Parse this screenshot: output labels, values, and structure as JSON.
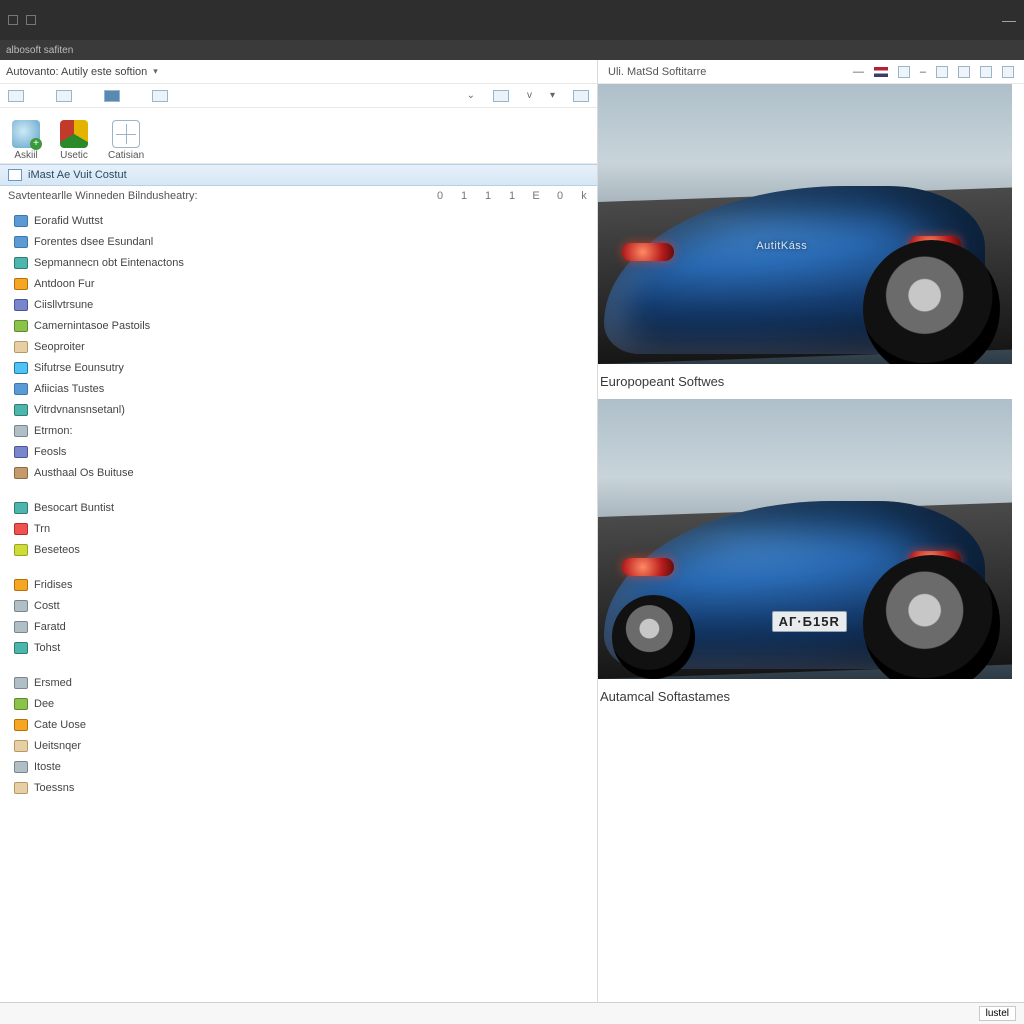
{
  "chrome": {
    "subtitle": "albosoft safiten",
    "minimize": "—"
  },
  "left": {
    "crumb": "Autovanto: Autily este softion",
    "toolbar": [
      {
        "name": "askil",
        "label": "Askiil"
      },
      {
        "name": "usetic",
        "label": "Usetic"
      },
      {
        "name": "catisian",
        "label": "Catisian"
      }
    ],
    "category_bar": "iMast Ae Vuit Costut",
    "section_title": "Savtentearlle Winneden Bilndusheatry:",
    "tally": [
      "0",
      "1",
      "1",
      "1",
      "E",
      "0",
      "k"
    ],
    "tree_a": [
      {
        "c": "c-blue",
        "t": "Eorafid Wuttst"
      },
      {
        "c": "c-blue",
        "t": "Forentes dsee Esundanl"
      },
      {
        "c": "c-teal",
        "t": "Sepmannecn obt Eintenactons"
      },
      {
        "c": "c-orange",
        "t": "Antdoon Fur"
      },
      {
        "c": "c-indigo",
        "t": "Ciisllvtrsune"
      },
      {
        "c": "c-green",
        "t": "Camernintasoe Pastoils"
      },
      {
        "c": "c-tan",
        "t": "Seoproiter"
      },
      {
        "c": "c-cyan",
        "t": "Sifutrse Eounsutry"
      },
      {
        "c": "c-blue",
        "t": "Afiicias Tustes"
      },
      {
        "c": "c-teal",
        "t": "Vitrdvnansnsetanl)"
      },
      {
        "c": "c-gray",
        "t": "Etrmon:"
      },
      {
        "c": "c-indigo",
        "t": "Feosls"
      },
      {
        "c": "c-brown",
        "t": "Austhaal Os Buituse"
      }
    ],
    "tree_b": [
      {
        "c": "c-teal",
        "t": "Besocart Buntist"
      },
      {
        "c": "c-red",
        "t": "Trn"
      },
      {
        "c": "c-lime",
        "t": "Beseteos"
      }
    ],
    "tree_c": [
      {
        "c": "c-orange",
        "t": "Fridises"
      },
      {
        "c": "c-gray",
        "t": "Costt"
      },
      {
        "c": "c-gray",
        "t": "Faratd"
      },
      {
        "c": "c-teal",
        "t": "Tohst"
      }
    ],
    "tree_d": [
      {
        "c": "c-gray",
        "t": "Ersmed"
      },
      {
        "c": "c-green",
        "t": "Dee"
      },
      {
        "c": "c-orange",
        "t": "Cate Uose"
      },
      {
        "c": "c-tan",
        "t": "Ueitsnqer"
      },
      {
        "c": "c-gray",
        "t": "Itoste"
      },
      {
        "c": "c-tan",
        "t": "Toessns"
      }
    ]
  },
  "right": {
    "header": "Uli. MatSd Softitarre",
    "min": "—",
    "cards": [
      {
        "badge": "AutitKáss",
        "plate": "",
        "caption": "Europopeant Softwes"
      },
      {
        "badge": "",
        "plate": "AГ·Б15R",
        "caption": "Autamcal Softastames"
      }
    ]
  },
  "status": {
    "button": "lustel"
  }
}
